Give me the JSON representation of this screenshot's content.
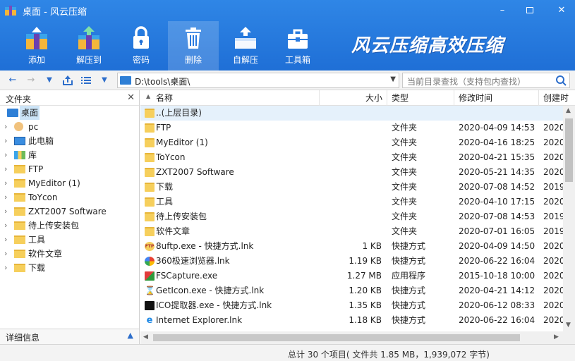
{
  "window": {
    "title": "桌面 - 风云压缩",
    "minimize": "–",
    "close": "✕"
  },
  "toolbar": {
    "items": [
      {
        "label": "添加"
      },
      {
        "label": "解压到"
      },
      {
        "label": "密码"
      },
      {
        "label": "删除"
      },
      {
        "label": "自解压"
      },
      {
        "label": "工具箱"
      }
    ],
    "brand": "风云压缩高效压缩"
  },
  "address": {
    "path": "D:\\tools\\桌面\\",
    "search_placeholder": "当前目录查找（支持包内查找）"
  },
  "left_panel": {
    "title": "文件夹",
    "tree": [
      {
        "label": "桌面",
        "icon": "desktop-icon"
      },
      {
        "label": "pc",
        "icon": "user-icon"
      },
      {
        "label": "此电脑",
        "icon": "computer-icon"
      },
      {
        "label": "库",
        "icon": "library-icon"
      },
      {
        "label": "FTP",
        "icon": "folder-icon"
      },
      {
        "label": "MyEditor (1)",
        "icon": "folder-icon"
      },
      {
        "label": "ToYcon",
        "icon": "folder-icon"
      },
      {
        "label": "ZXT2007 Software",
        "icon": "folder-icon"
      },
      {
        "label": "待上传安装包",
        "icon": "folder-icon"
      },
      {
        "label": "工具",
        "icon": "folder-icon"
      },
      {
        "label": "软件文章",
        "icon": "folder-icon"
      },
      {
        "label": "下载",
        "icon": "folder-icon"
      }
    ],
    "detail_title": "详细信息"
  },
  "list": {
    "columns": {
      "name": "名称",
      "size": "大小",
      "type": "类型",
      "modified": "修改时间",
      "created": "创建时"
    },
    "up_row": "..(上层目录)",
    "rows": [
      {
        "name": "FTP",
        "size": "",
        "type": "文件夹",
        "modified": "2020-04-09 14:53",
        "created": "2020",
        "icon": "folder-icon"
      },
      {
        "name": "MyEditor (1)",
        "size": "",
        "type": "文件夹",
        "modified": "2020-04-16 18:25",
        "created": "2020",
        "icon": "folder-icon"
      },
      {
        "name": "ToYcon",
        "size": "",
        "type": "文件夹",
        "modified": "2020-04-21 15:35",
        "created": "2020",
        "icon": "folder-icon"
      },
      {
        "name": "ZXT2007 Software",
        "size": "",
        "type": "文件夹",
        "modified": "2020-05-21 14:35",
        "created": "2020",
        "icon": "folder-icon"
      },
      {
        "name": "下载",
        "size": "",
        "type": "文件夹",
        "modified": "2020-07-08 14:52",
        "created": "2019",
        "icon": "folder-icon"
      },
      {
        "name": "工具",
        "size": "",
        "type": "文件夹",
        "modified": "2020-04-10 17:15",
        "created": "2020",
        "icon": "folder-icon"
      },
      {
        "name": "待上传安装包",
        "size": "",
        "type": "文件夹",
        "modified": "2020-07-08 14:53",
        "created": "2019",
        "icon": "folder-icon"
      },
      {
        "name": "软件文章",
        "size": "",
        "type": "文件夹",
        "modified": "2020-07-01 16:05",
        "created": "2019",
        "icon": "folder-icon"
      },
      {
        "name": "8uftp.exe - 快捷方式.lnk",
        "size": "1 KB",
        "type": "快捷方式",
        "modified": "2020-04-09 14:50",
        "created": "2020",
        "icon": "ftp-app-icon"
      },
      {
        "name": "360极速浏览器.lnk",
        "size": "1.19 KB",
        "type": "快捷方式",
        "modified": "2020-06-22 16:04",
        "created": "2020",
        "icon": "browser-360-icon"
      },
      {
        "name": "FSCapture.exe",
        "size": "1.27 MB",
        "type": "应用程序",
        "modified": "2015-10-18 10:00",
        "created": "2020",
        "icon": "capture-app-icon"
      },
      {
        "name": "GetIcon.exe - 快捷方式.lnk",
        "size": "1.20 KB",
        "type": "快捷方式",
        "modified": "2020-04-21 14:12",
        "created": "2020",
        "icon": "hourglass-icon"
      },
      {
        "name": "ICO提取器.exe - 快捷方式.lnk",
        "size": "1.35 KB",
        "type": "快捷方式",
        "modified": "2020-06-12 08:33",
        "created": "2020",
        "icon": "ico-extractor-icon"
      },
      {
        "name": "Internet  Explorer.lnk",
        "size": "1.18 KB",
        "type": "快捷方式",
        "modified": "2020-06-22 16:04",
        "created": "2020",
        "icon": "ie-icon"
      }
    ]
  },
  "status": {
    "text": "总计 30 个项目( 文件共 1.85 MB，1,939,072 字节)"
  },
  "colors": {
    "accent": "#1f6fd6",
    "folder": "#f6cf5c",
    "selection": "#cce4f7"
  }
}
